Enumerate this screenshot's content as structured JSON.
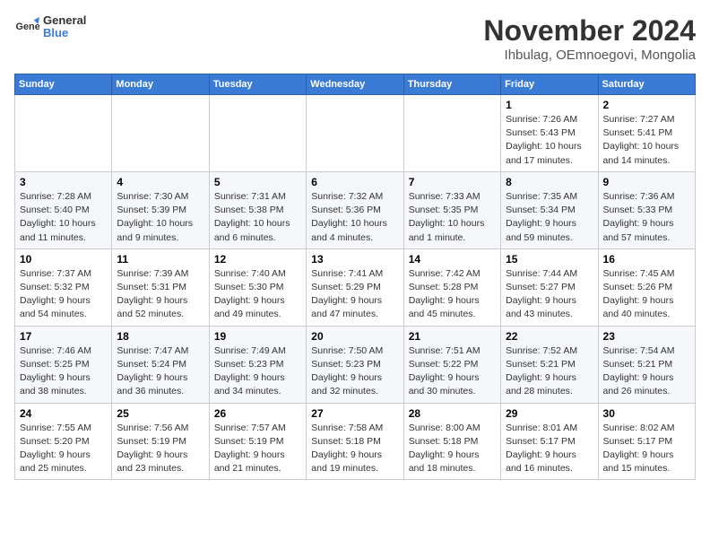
{
  "logo": {
    "line1": "General",
    "line2": "Blue"
  },
  "title": "November 2024",
  "location": "Ihbulag, OEmnoegovi, Mongolia",
  "weekdays": [
    "Sunday",
    "Monday",
    "Tuesday",
    "Wednesday",
    "Thursday",
    "Friday",
    "Saturday"
  ],
  "weeks": [
    [
      {
        "day": "",
        "info": ""
      },
      {
        "day": "",
        "info": ""
      },
      {
        "day": "",
        "info": ""
      },
      {
        "day": "",
        "info": ""
      },
      {
        "day": "",
        "info": ""
      },
      {
        "day": "1",
        "info": "Sunrise: 7:26 AM\nSunset: 5:43 PM\nDaylight: 10 hours and 17 minutes."
      },
      {
        "day": "2",
        "info": "Sunrise: 7:27 AM\nSunset: 5:41 PM\nDaylight: 10 hours and 14 minutes."
      }
    ],
    [
      {
        "day": "3",
        "info": "Sunrise: 7:28 AM\nSunset: 5:40 PM\nDaylight: 10 hours and 11 minutes."
      },
      {
        "day": "4",
        "info": "Sunrise: 7:30 AM\nSunset: 5:39 PM\nDaylight: 10 hours and 9 minutes."
      },
      {
        "day": "5",
        "info": "Sunrise: 7:31 AM\nSunset: 5:38 PM\nDaylight: 10 hours and 6 minutes."
      },
      {
        "day": "6",
        "info": "Sunrise: 7:32 AM\nSunset: 5:36 PM\nDaylight: 10 hours and 4 minutes."
      },
      {
        "day": "7",
        "info": "Sunrise: 7:33 AM\nSunset: 5:35 PM\nDaylight: 10 hours and 1 minute."
      },
      {
        "day": "8",
        "info": "Sunrise: 7:35 AM\nSunset: 5:34 PM\nDaylight: 9 hours and 59 minutes."
      },
      {
        "day": "9",
        "info": "Sunrise: 7:36 AM\nSunset: 5:33 PM\nDaylight: 9 hours and 57 minutes."
      }
    ],
    [
      {
        "day": "10",
        "info": "Sunrise: 7:37 AM\nSunset: 5:32 PM\nDaylight: 9 hours and 54 minutes."
      },
      {
        "day": "11",
        "info": "Sunrise: 7:39 AM\nSunset: 5:31 PM\nDaylight: 9 hours and 52 minutes."
      },
      {
        "day": "12",
        "info": "Sunrise: 7:40 AM\nSunset: 5:30 PM\nDaylight: 9 hours and 49 minutes."
      },
      {
        "day": "13",
        "info": "Sunrise: 7:41 AM\nSunset: 5:29 PM\nDaylight: 9 hours and 47 minutes."
      },
      {
        "day": "14",
        "info": "Sunrise: 7:42 AM\nSunset: 5:28 PM\nDaylight: 9 hours and 45 minutes."
      },
      {
        "day": "15",
        "info": "Sunrise: 7:44 AM\nSunset: 5:27 PM\nDaylight: 9 hours and 43 minutes."
      },
      {
        "day": "16",
        "info": "Sunrise: 7:45 AM\nSunset: 5:26 PM\nDaylight: 9 hours and 40 minutes."
      }
    ],
    [
      {
        "day": "17",
        "info": "Sunrise: 7:46 AM\nSunset: 5:25 PM\nDaylight: 9 hours and 38 minutes."
      },
      {
        "day": "18",
        "info": "Sunrise: 7:47 AM\nSunset: 5:24 PM\nDaylight: 9 hours and 36 minutes."
      },
      {
        "day": "19",
        "info": "Sunrise: 7:49 AM\nSunset: 5:23 PM\nDaylight: 9 hours and 34 minutes."
      },
      {
        "day": "20",
        "info": "Sunrise: 7:50 AM\nSunset: 5:23 PM\nDaylight: 9 hours and 32 minutes."
      },
      {
        "day": "21",
        "info": "Sunrise: 7:51 AM\nSunset: 5:22 PM\nDaylight: 9 hours and 30 minutes."
      },
      {
        "day": "22",
        "info": "Sunrise: 7:52 AM\nSunset: 5:21 PM\nDaylight: 9 hours and 28 minutes."
      },
      {
        "day": "23",
        "info": "Sunrise: 7:54 AM\nSunset: 5:21 PM\nDaylight: 9 hours and 26 minutes."
      }
    ],
    [
      {
        "day": "24",
        "info": "Sunrise: 7:55 AM\nSunset: 5:20 PM\nDaylight: 9 hours and 25 minutes."
      },
      {
        "day": "25",
        "info": "Sunrise: 7:56 AM\nSunset: 5:19 PM\nDaylight: 9 hours and 23 minutes."
      },
      {
        "day": "26",
        "info": "Sunrise: 7:57 AM\nSunset: 5:19 PM\nDaylight: 9 hours and 21 minutes."
      },
      {
        "day": "27",
        "info": "Sunrise: 7:58 AM\nSunset: 5:18 PM\nDaylight: 9 hours and 19 minutes."
      },
      {
        "day": "28",
        "info": "Sunrise: 8:00 AM\nSunset: 5:18 PM\nDaylight: 9 hours and 18 minutes."
      },
      {
        "day": "29",
        "info": "Sunrise: 8:01 AM\nSunset: 5:17 PM\nDaylight: 9 hours and 16 minutes."
      },
      {
        "day": "30",
        "info": "Sunrise: 8:02 AM\nSunset: 5:17 PM\nDaylight: 9 hours and 15 minutes."
      }
    ]
  ]
}
